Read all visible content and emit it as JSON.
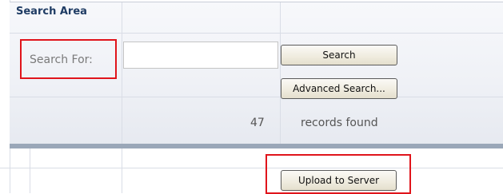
{
  "panel": {
    "title": "Search Area"
  },
  "search": {
    "label": "Search For:",
    "input_value": "",
    "search_button": "Search",
    "advanced_button": "Advanced Search...",
    "result_count": "47",
    "result_label": "records found"
  },
  "footer": {
    "upload_button": "Upload to Server"
  },
  "colors": {
    "highlight": "#e0141b",
    "title": "#1f3c64",
    "panel_bottom_bar": "#9aa7b8"
  }
}
